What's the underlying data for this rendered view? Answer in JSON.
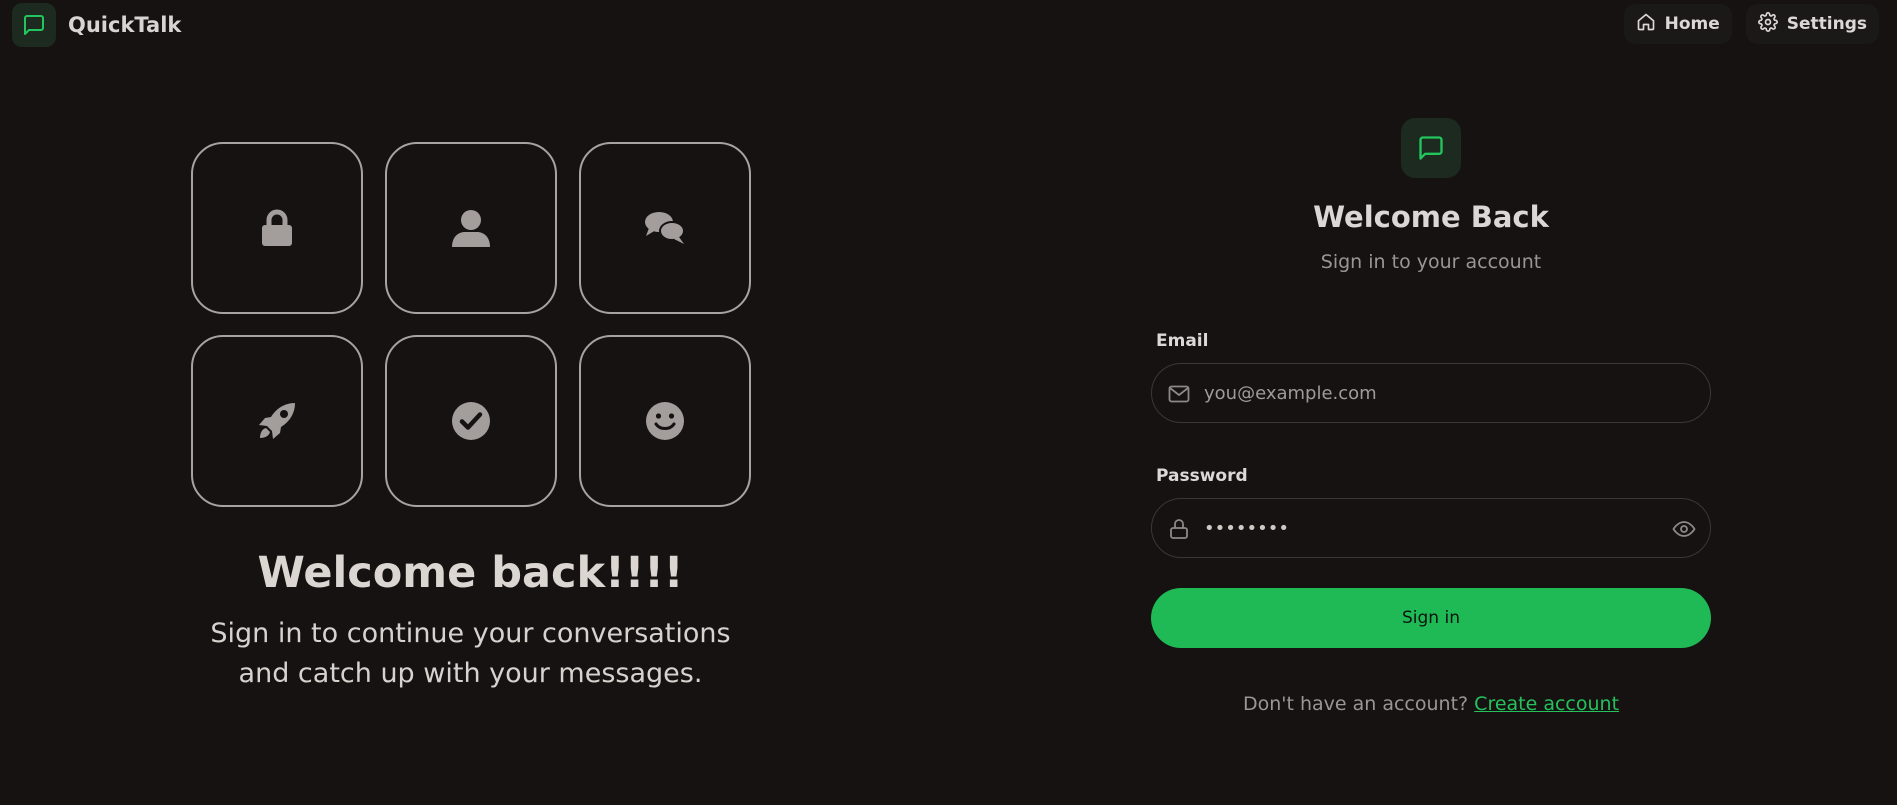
{
  "header": {
    "brand_name": "QuickTalk",
    "nav": {
      "home_label": "Home",
      "settings_label": "Settings"
    }
  },
  "hero": {
    "tiles": [
      {
        "icon": "lock-icon"
      },
      {
        "icon": "user-icon"
      },
      {
        "icon": "comments-icon"
      },
      {
        "icon": "rocket-icon"
      },
      {
        "icon": "check-circle-icon"
      },
      {
        "icon": "smile-icon"
      }
    ],
    "title": "Welcome back!!!!",
    "subtitle": "Sign in to continue your conversations and catch up with your messages."
  },
  "form": {
    "title": "Welcome Back",
    "subtitle": "Sign in to your account",
    "email": {
      "label": "Email",
      "placeholder": "you@example.com",
      "value": ""
    },
    "password": {
      "label": "Password",
      "value": "••••••••"
    },
    "submit_label": "Sign in",
    "signup_prompt": "Don't have an account?",
    "signup_link": "Create account"
  },
  "colors": {
    "background": "#161212",
    "accent": "#1fba55",
    "tile_border": "#a8a2a0",
    "icon_gray": "#a39d9b"
  }
}
